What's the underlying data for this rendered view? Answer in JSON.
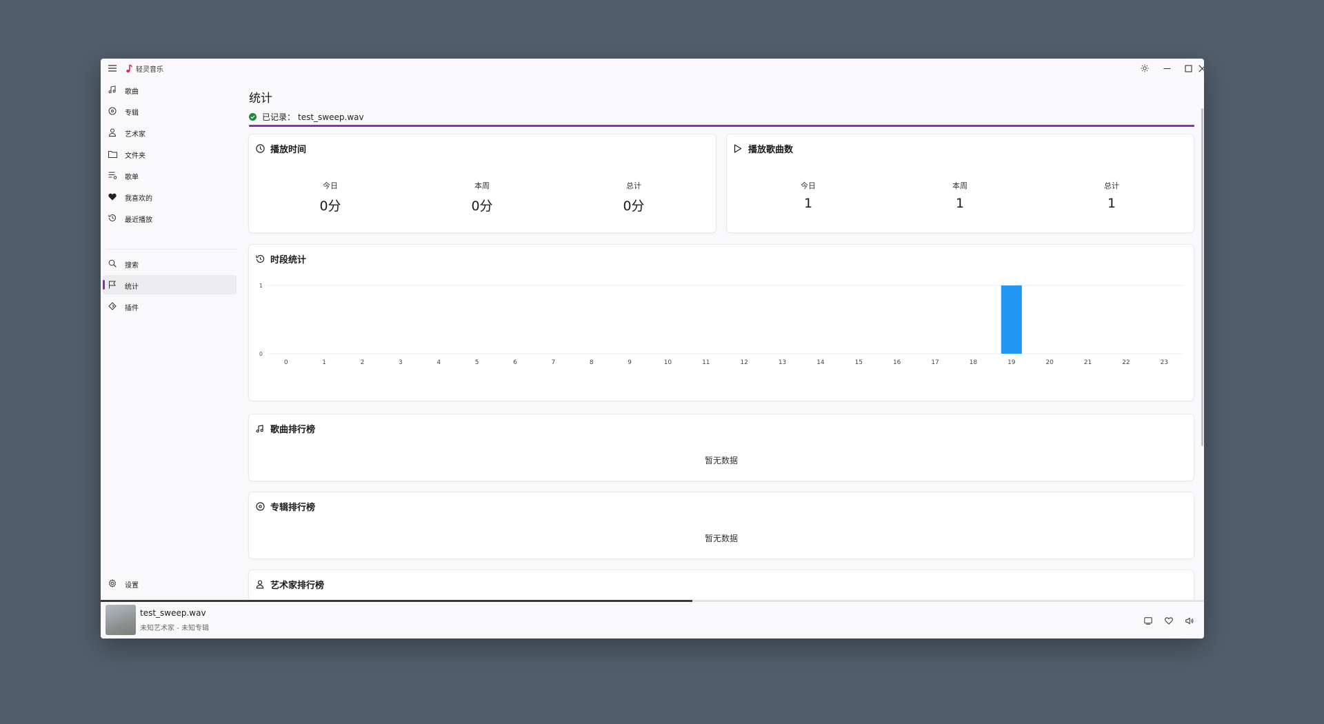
{
  "app": {
    "title": "轻灵音乐"
  },
  "sidebar": {
    "items": [
      {
        "label": "歌曲",
        "icon": "music-note-icon"
      },
      {
        "label": "专辑",
        "icon": "disc-icon"
      },
      {
        "label": "艺术家",
        "icon": "person-icon"
      },
      {
        "label": "文件夹",
        "icon": "folder-icon"
      },
      {
        "label": "歌单",
        "icon": "playlist-icon"
      },
      {
        "label": "我喜欢的",
        "icon": "heart-icon"
      },
      {
        "label": "最近播放",
        "icon": "history-icon"
      },
      {
        "label": "搜索",
        "icon": "search-icon"
      },
      {
        "label": "统计",
        "icon": "flag-icon",
        "active": true
      },
      {
        "label": "插件",
        "icon": "plugin-icon"
      }
    ],
    "settings_label": "设置"
  },
  "page": {
    "title": "统计",
    "recorded_label": "已记录：",
    "recorded_file": "test_sweep.wav"
  },
  "play_time": {
    "title": "播放时间",
    "today_label": "今日",
    "today_value": "0分",
    "week_label": "本周",
    "week_value": "0分",
    "total_label": "总计",
    "total_value": "0分"
  },
  "play_count": {
    "title": "播放歌曲数",
    "today_label": "今日",
    "today_value": "1",
    "week_label": "本周",
    "week_value": "1",
    "total_label": "总计",
    "total_value": "1"
  },
  "period": {
    "title": "时段统计"
  },
  "rank_songs": {
    "title": "歌曲排行榜",
    "empty": "暂无数据"
  },
  "rank_albums": {
    "title": "专辑排行榜",
    "empty": "暂无数据"
  },
  "rank_artists": {
    "title": "艺术家排行榜"
  },
  "player": {
    "title": "test_sweep.wav",
    "subtitle": "未知艺术家 - 未知专辑",
    "progress": 0.536
  },
  "colors": {
    "accent": "#8b2fb6",
    "bar": "#2196f3",
    "ok": "#1e8a35"
  },
  "chart_data": {
    "type": "bar",
    "categories": [
      "0",
      "1",
      "2",
      "3",
      "4",
      "5",
      "6",
      "7",
      "8",
      "9",
      "10",
      "11",
      "12",
      "13",
      "14",
      "15",
      "16",
      "17",
      "18",
      "19",
      "20",
      "21",
      "22",
      "23"
    ],
    "values": [
      0,
      0,
      0,
      0,
      0,
      0,
      0,
      0,
      0,
      0,
      0,
      0,
      0,
      0,
      0,
      0,
      0,
      0,
      0,
      1,
      0,
      0,
      0,
      0
    ],
    "ylim": [
      0,
      1
    ],
    "yticks": [
      0,
      1
    ],
    "grid": true
  }
}
